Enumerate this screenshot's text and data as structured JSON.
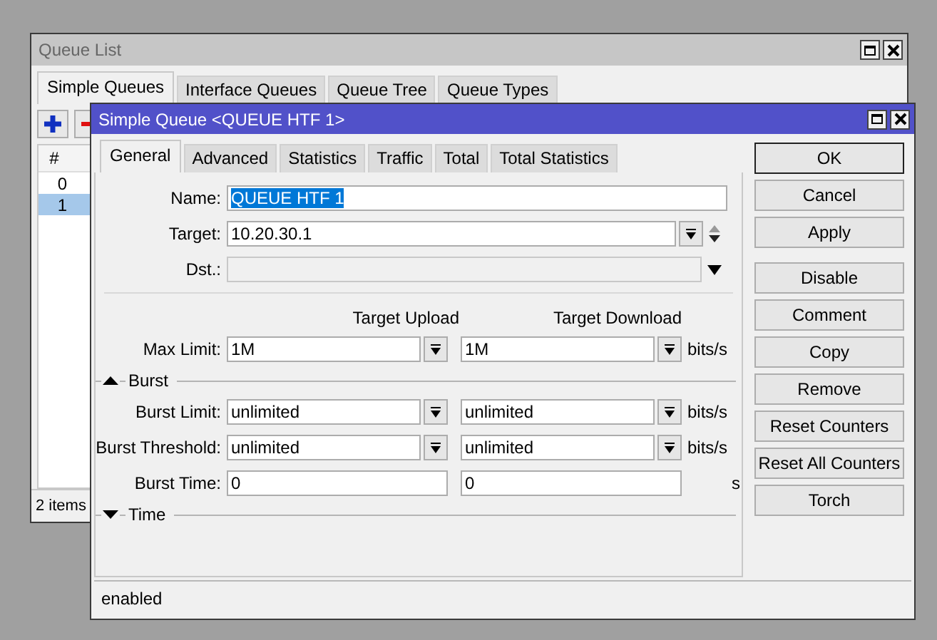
{
  "queue_list": {
    "title": "Queue List",
    "tabs": [
      {
        "label": "Simple Queues",
        "selected": true
      },
      {
        "label": "Interface Queues",
        "selected": false
      },
      {
        "label": "Queue Tree",
        "selected": false
      },
      {
        "label": "Queue Types",
        "selected": false
      }
    ],
    "table": {
      "columns": [
        "#"
      ],
      "rows": [
        {
          "cells": [
            "0"
          ],
          "selected": false
        },
        {
          "cells": [
            "1"
          ],
          "selected": true
        }
      ]
    },
    "status": "2 items"
  },
  "dialog": {
    "title": "Simple Queue <QUEUE HTF 1>",
    "tabs": [
      {
        "label": "General",
        "selected": true
      },
      {
        "label": "Advanced",
        "selected": false
      },
      {
        "label": "Statistics",
        "selected": false
      },
      {
        "label": "Traffic",
        "selected": false
      },
      {
        "label": "Total",
        "selected": false
      },
      {
        "label": "Total Statistics",
        "selected": false
      }
    ],
    "name": {
      "label": "Name:",
      "value": "QUEUE HTF 1",
      "highlighted": true
    },
    "target": {
      "label": "Target:",
      "value": "10.20.30.1"
    },
    "dst": {
      "label": "Dst.:",
      "disabled": true
    },
    "columns": [
      "Target Upload",
      "Target Download"
    ],
    "max_limit": {
      "label": "Max Limit:",
      "upload": "1M",
      "download": "1M",
      "unit": "bits/s",
      "kind": "dropdown"
    },
    "sections": [
      {
        "title": "Burst",
        "expanded": true,
        "rows": [
          {
            "label": "Burst Limit:",
            "upload": "unlimited",
            "download": "unlimited",
            "unit": "bits/s",
            "kind": "dropdown"
          },
          {
            "label": "Burst Threshold:",
            "upload": "unlimited",
            "download": "unlimited",
            "unit": "bits/s",
            "kind": "dropdown"
          },
          {
            "label": "Burst Time:",
            "upload": "0",
            "download": "0",
            "unit": "s",
            "kind": "plain"
          }
        ]
      },
      {
        "title": "Time",
        "expanded": false
      }
    ],
    "buttons_primary": [
      {
        "label": "OK",
        "default": true
      },
      {
        "label": "Cancel",
        "default": false
      },
      {
        "label": "Apply",
        "default": false
      }
    ],
    "buttons_actions": [
      {
        "label": "Disable",
        "default": false
      },
      {
        "label": "Comment",
        "default": false
      },
      {
        "label": "Copy",
        "default": false
      },
      {
        "label": "Remove",
        "default": false
      },
      {
        "label": "Reset Counters",
        "default": false
      },
      {
        "label": "Reset All Counters",
        "default": false
      },
      {
        "label": "Torch",
        "default": false
      }
    ],
    "status": "enabled"
  }
}
